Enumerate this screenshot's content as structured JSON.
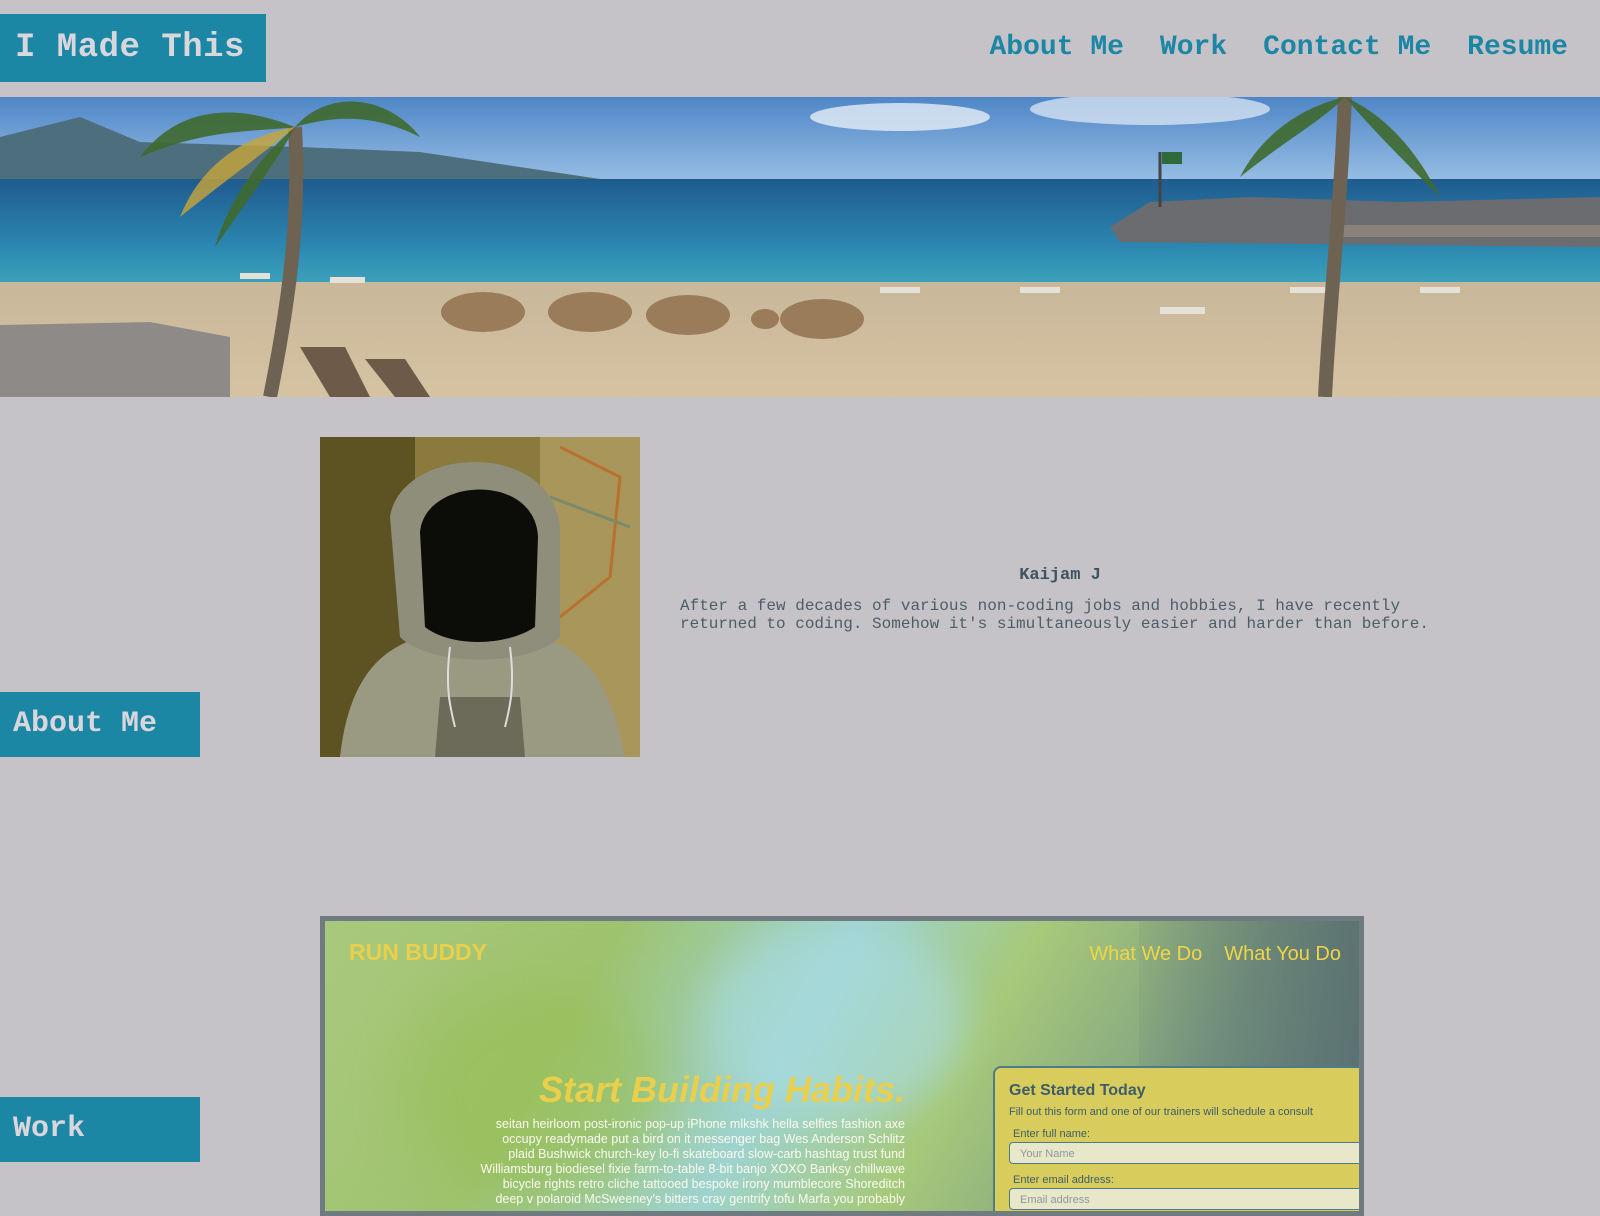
{
  "header": {
    "logo": "I Made This",
    "nav": [
      "About Me",
      "Work",
      "Contact Me",
      "Resume"
    ]
  },
  "hero": {
    "alt": "beach"
  },
  "about": {
    "section_label": "About Me",
    "name": "Kaijam J",
    "bio": "After a few decades of various non-coding jobs and hobbies, I have recently returned to coding. Somehow it's simultaneously easier and harder than before."
  },
  "work": {
    "section_label": "Work",
    "project": {
      "logo": "RUN BUDDY",
      "nav": [
        "What We Do",
        "What You Do"
      ],
      "headline": "Start Building Habits.",
      "lorem": "seitan heirloom post-ironic pop-up iPhone mlkshk hella selfies fashion axe occupy readymade put a bird on it messenger bag Wes Anderson Schlitz plaid Bushwick church-key lo-fi skateboard slow-carb hashtag trust fund Williamsburg biodiesel fixie farm-to-table 8-bit banjo XOXO Banksy chillwave bicycle rights retro cliche tattooed bespoke irony mumblecore Shoreditch deep v polaroid McSweeney's bitters cray gentrify tofu Marfa you probably",
      "form": {
        "title": "Get Started Today",
        "subtitle": "Fill out this form and one of our trainers will schedule a consult",
        "name_label": "Enter full name:",
        "name_placeholder": "Your Name",
        "email_label": "Enter email address:",
        "email_placeholder": "Email address"
      }
    }
  },
  "colors": {
    "accent": "#1b87a5",
    "background": "#c6c3c8",
    "runbuddy_yellow": "#e9cf4c"
  }
}
